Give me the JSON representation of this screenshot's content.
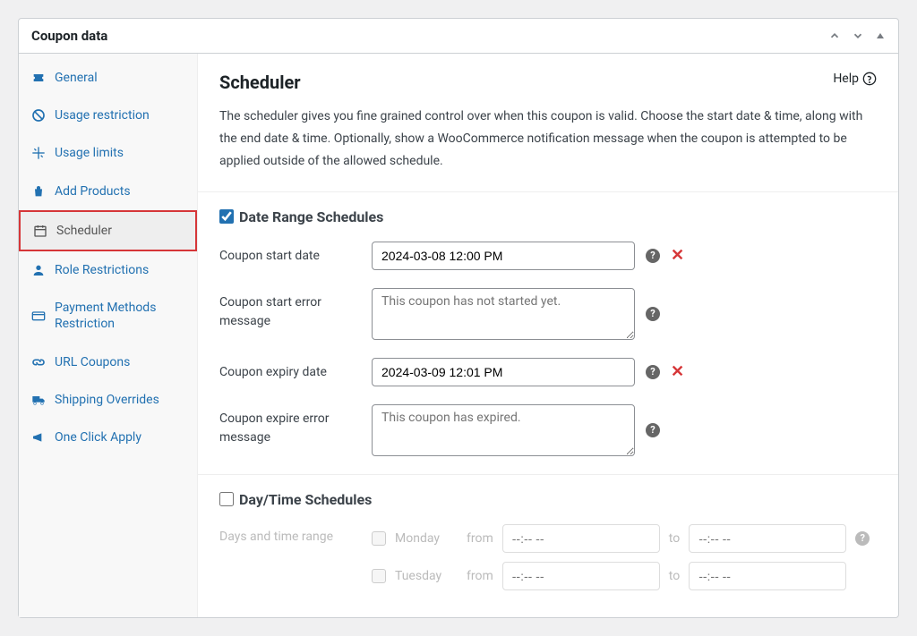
{
  "panel": {
    "title": "Coupon data"
  },
  "sidebar": {
    "items": [
      {
        "label": "General",
        "icon": "ticket"
      },
      {
        "label": "Usage restriction",
        "icon": "ban"
      },
      {
        "label": "Usage limits",
        "icon": "adjust"
      },
      {
        "label": "Add Products",
        "icon": "bag"
      },
      {
        "label": "Scheduler",
        "icon": "calendar",
        "active": true,
        "highlighted": true
      },
      {
        "label": "Role Restrictions",
        "icon": "user"
      },
      {
        "label": "Payment Methods Restriction",
        "icon": "card"
      },
      {
        "label": "URL Coupons",
        "icon": "link"
      },
      {
        "label": "Shipping Overrides",
        "icon": "truck"
      },
      {
        "label": "One Click Apply",
        "icon": "megaphone"
      }
    ]
  },
  "content": {
    "title": "Scheduler",
    "help_label": "Help",
    "description": "The scheduler gives you fine grained control over when this coupon is valid. Choose the start date & time, along with the end date & time. Optionally, show a WooCommerce notification message when the coupon is attempted to be applied outside of the allowed schedule.",
    "date_range": {
      "title": "Date Range Schedules",
      "checked": true,
      "start_date_label": "Coupon start date",
      "start_date_value": "2024-03-08 12:00 PM",
      "start_error_label": "Coupon start error message",
      "start_error_placeholder": "This coupon has not started yet.",
      "expiry_date_label": "Coupon expiry date",
      "expiry_date_value": "2024-03-09 12:01 PM",
      "expire_error_label": "Coupon expire error message",
      "expire_error_placeholder": "This coupon has expired."
    },
    "day_time": {
      "title": "Day/Time Schedules",
      "checked": false,
      "range_label": "Days and time range",
      "from_label": "from",
      "to_label": "to",
      "time_placeholder": "--:-- --",
      "days": [
        "Monday",
        "Tuesday"
      ]
    }
  }
}
